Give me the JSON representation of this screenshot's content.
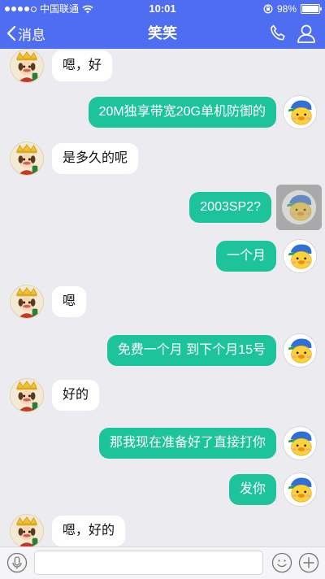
{
  "status_bar": {
    "carrier": "中国联通",
    "time": "10:01",
    "battery": "98%",
    "battery_level": 0.98,
    "signal_bars": 4
  },
  "nav": {
    "back_label": "消息",
    "title": "笑笑",
    "phone_icon": "phone-icon",
    "profile_icon": "user-icon"
  },
  "messages": [
    {
      "side": "left",
      "text": "嗯，好"
    },
    {
      "side": "right",
      "text": "20M独享带宽20G单机防御的"
    },
    {
      "side": "left",
      "text": "是多久的呢"
    },
    {
      "side": "right",
      "text": "2003SP2?",
      "avatar_dimmed": true
    },
    {
      "side": "right",
      "text": "一个月"
    },
    {
      "side": "left",
      "text": "嗯"
    },
    {
      "side": "right",
      "text": "免费一个月 到下个月15号"
    },
    {
      "side": "left",
      "text": "好的"
    },
    {
      "side": "right",
      "text": "那我现在准备好了直接打你"
    },
    {
      "side": "right",
      "text": "发你"
    },
    {
      "side": "left",
      "text": "嗯，好的"
    }
  ],
  "input_bar": {
    "value": "",
    "placeholder": "",
    "icons": [
      "microphone-icon",
      "emoji-icon",
      "plus-icon"
    ]
  },
  "colors": {
    "header": "#4f6df1",
    "outgoing_bubble": "#1cc39b",
    "incoming_bubble": "#ffffff",
    "background": "#ececf0"
  }
}
